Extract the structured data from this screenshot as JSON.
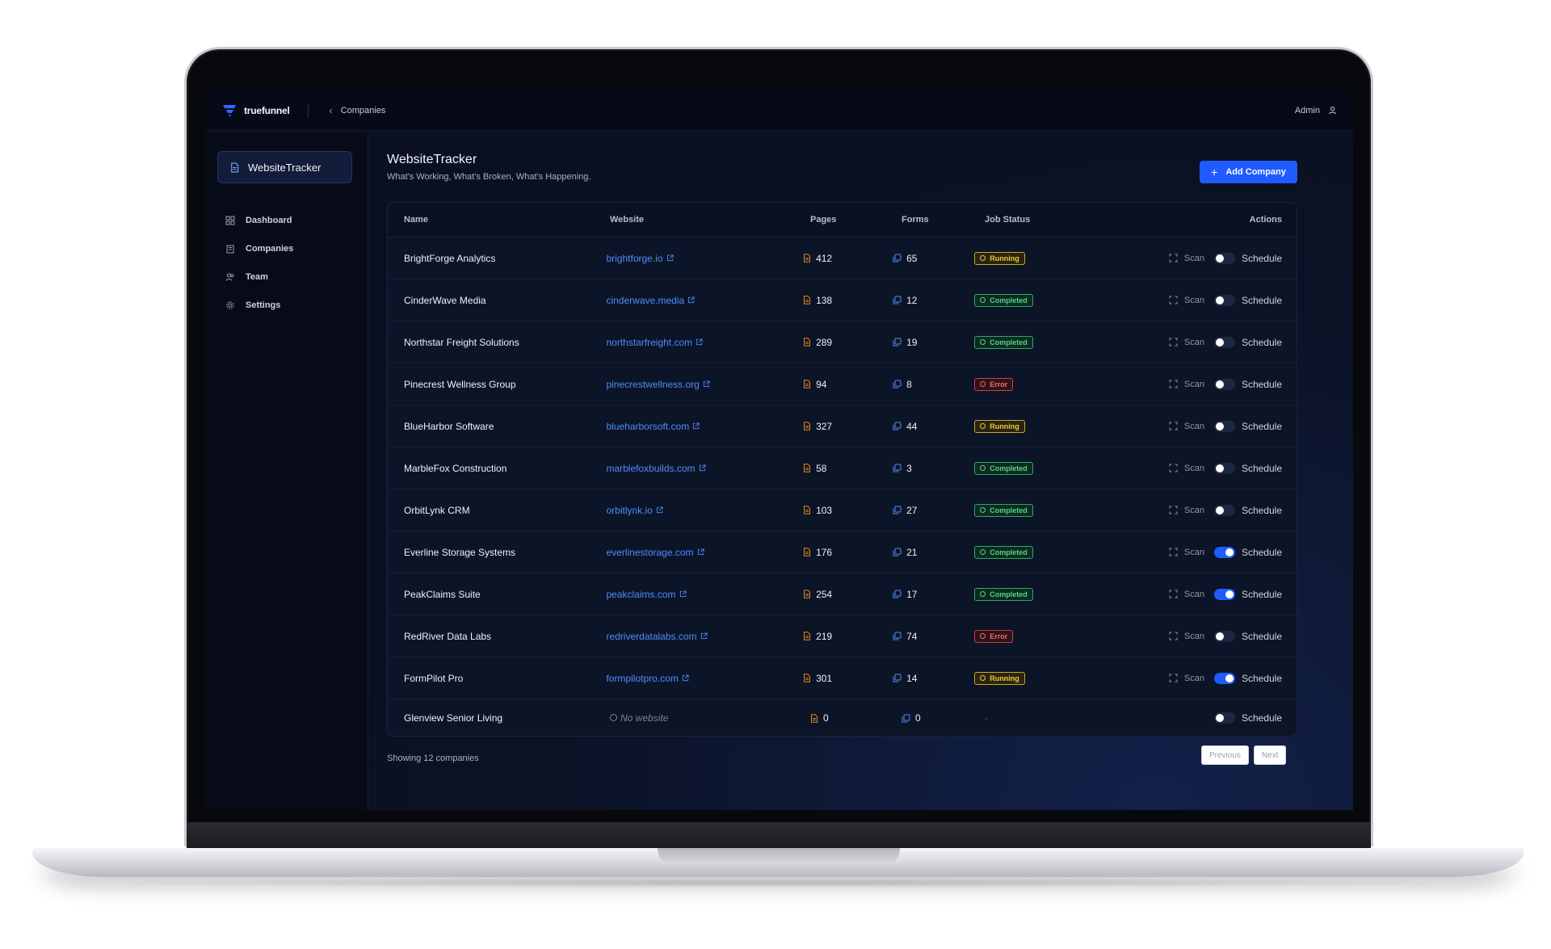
{
  "topbar": {
    "logo_text": "truefunnel",
    "breadcrumb": "Companies",
    "user": "Admin"
  },
  "sidebar": {
    "app_name": "WebsiteTracker",
    "items": [
      {
        "label": "Dashboard",
        "icon": "grid-icon"
      },
      {
        "label": "Companies",
        "icon": "building-icon"
      },
      {
        "label": "Team",
        "icon": "users-icon"
      },
      {
        "label": "Settings",
        "icon": "gear-icon"
      }
    ]
  },
  "page": {
    "title": "WebsiteTracker",
    "subtitle": "What's Working, What's Broken, What's Happening.",
    "add_button": "Add Company"
  },
  "table": {
    "headers": {
      "name": "Name",
      "website": "Website",
      "pages": "Pages",
      "forms": "Forms",
      "status": "Job Status",
      "actions": "Actions"
    },
    "scan_label": "Scan",
    "schedule_label": "Schedule",
    "rows": [
      {
        "name": "BrightForge Analytics",
        "website": "brightforge.io",
        "pages": "412",
        "forms": "65",
        "status": "Running",
        "schedule_on": false
      },
      {
        "name": "CinderWave Media",
        "website": "cinderwave.media",
        "pages": "138",
        "forms": "12",
        "status": "Completed",
        "schedule_on": false
      },
      {
        "name": "Northstar Freight Solutions",
        "website": "northstarfreight.com",
        "pages": "289",
        "forms": "19",
        "status": "Completed",
        "schedule_on": false
      },
      {
        "name": "Pinecrest Wellness Group",
        "website": "pinecrestwellness.org",
        "pages": "94",
        "forms": "8",
        "status": "Error",
        "schedule_on": false
      },
      {
        "name": "BlueHarbor Software",
        "website": "blueharborsoft.com",
        "pages": "327",
        "forms": "44",
        "status": "Running",
        "schedule_on": false
      },
      {
        "name": "MarbleFox Construction",
        "website": "marblefoxbuilds.com",
        "pages": "58",
        "forms": "3",
        "status": "Completed",
        "schedule_on": false
      },
      {
        "name": "OrbitLynk CRM",
        "website": "orbitlynk.io",
        "pages": "103",
        "forms": "27",
        "status": "Completed",
        "schedule_on": false
      },
      {
        "name": "Everline Storage Systems",
        "website": "everlinestorage.com",
        "pages": "176",
        "forms": "21",
        "status": "Completed",
        "schedule_on": true
      },
      {
        "name": "PeakClaims Suite",
        "website": "peakclaims.com",
        "pages": "254",
        "forms": "17",
        "status": "Completed",
        "schedule_on": true
      },
      {
        "name": "RedRiver Data Labs",
        "website": "redriverdatalabs.com",
        "pages": "219",
        "forms": "74",
        "status": "Error",
        "schedule_on": false
      },
      {
        "name": "FormPilot Pro",
        "website": "formpilotpro.com",
        "pages": "301",
        "forms": "14",
        "status": "Running",
        "schedule_on": true
      },
      {
        "name": "Glenview Senior Living",
        "website": "",
        "no_website_label": "No website",
        "pages": "0",
        "forms": "0",
        "status": "-",
        "schedule_on": false
      }
    ]
  },
  "footer": {
    "showing": "Showing 12 companies",
    "prev": "Previous",
    "next": "Next"
  },
  "colors": {
    "accent": "#1f5bff",
    "link": "#4f8dfa",
    "running": "#f0c93a",
    "completed": "#4fd38f",
    "error": "#f06a76",
    "file_icon": "#e8891c"
  }
}
